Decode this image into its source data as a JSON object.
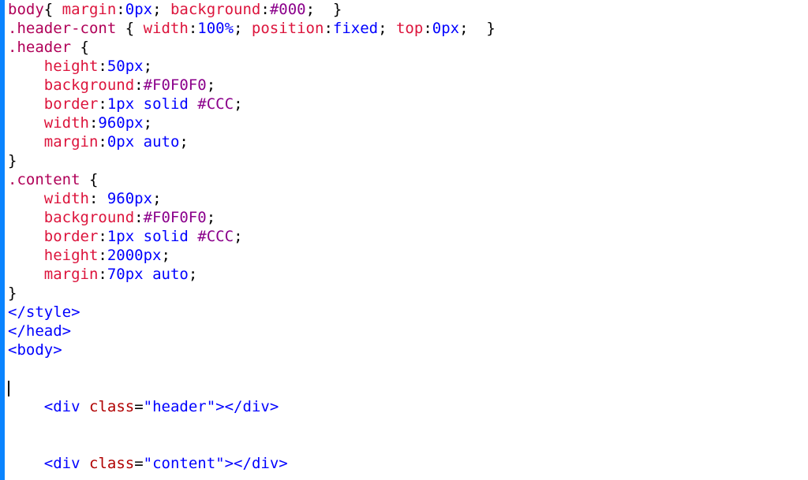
{
  "lines": [
    {
      "indent": 0,
      "tokens": [
        {
          "t": "body",
          "c": "sel"
        },
        {
          "t": "{ ",
          "c": "brace"
        },
        {
          "t": "margin",
          "c": "prop"
        },
        {
          "t": ":",
          "c": "punct"
        },
        {
          "t": "0px",
          "c": "num"
        },
        {
          "t": "; ",
          "c": "punct"
        },
        {
          "t": "background",
          "c": "prop"
        },
        {
          "t": ":",
          "c": "punct"
        },
        {
          "t": "#000",
          "c": "col"
        },
        {
          "t": "; ",
          "c": "punct"
        },
        {
          "t": " }",
          "c": "brace"
        }
      ]
    },
    {
      "indent": 0,
      "tokens": [
        {
          "t": ".header-cont",
          "c": "sel"
        },
        {
          "t": " { ",
          "c": "brace"
        },
        {
          "t": "width",
          "c": "prop"
        },
        {
          "t": ":",
          "c": "punct"
        },
        {
          "t": "100%",
          "c": "pct"
        },
        {
          "t": "; ",
          "c": "punct"
        },
        {
          "t": "position",
          "c": "prop"
        },
        {
          "t": ":",
          "c": "punct"
        },
        {
          "t": "fixed",
          "c": "kw"
        },
        {
          "t": "; ",
          "c": "punct"
        },
        {
          "t": "top",
          "c": "prop"
        },
        {
          "t": ":",
          "c": "punct"
        },
        {
          "t": "0px",
          "c": "num"
        },
        {
          "t": "; ",
          "c": "punct"
        },
        {
          "t": " }",
          "c": "brace"
        }
      ]
    },
    {
      "indent": 0,
      "tokens": [
        {
          "t": ".header",
          "c": "sel"
        },
        {
          "t": " {",
          "c": "brace"
        }
      ]
    },
    {
      "indent": 1,
      "tokens": [
        {
          "t": "height",
          "c": "prop"
        },
        {
          "t": ":",
          "c": "punct"
        },
        {
          "t": "50px",
          "c": "num"
        },
        {
          "t": ";",
          "c": "punct"
        }
      ]
    },
    {
      "indent": 1,
      "tokens": [
        {
          "t": "background",
          "c": "prop"
        },
        {
          "t": ":",
          "c": "punct"
        },
        {
          "t": "#F0F0F0",
          "c": "col"
        },
        {
          "t": ";",
          "c": "punct"
        }
      ]
    },
    {
      "indent": 1,
      "tokens": [
        {
          "t": "border",
          "c": "prop"
        },
        {
          "t": ":",
          "c": "punct"
        },
        {
          "t": "1px",
          "c": "num"
        },
        {
          "t": " ",
          "c": "punct"
        },
        {
          "t": "solid",
          "c": "kw"
        },
        {
          "t": " ",
          "c": "punct"
        },
        {
          "t": "#CCC",
          "c": "col"
        },
        {
          "t": ";",
          "c": "punct"
        }
      ]
    },
    {
      "indent": 1,
      "tokens": [
        {
          "t": "width",
          "c": "prop"
        },
        {
          "t": ":",
          "c": "punct"
        },
        {
          "t": "960px",
          "c": "num"
        },
        {
          "t": ";",
          "c": "punct"
        }
      ]
    },
    {
      "indent": 1,
      "tokens": [
        {
          "t": "margin",
          "c": "prop"
        },
        {
          "t": ":",
          "c": "punct"
        },
        {
          "t": "0px",
          "c": "num"
        },
        {
          "t": " ",
          "c": "punct"
        },
        {
          "t": "auto",
          "c": "kw"
        },
        {
          "t": ";",
          "c": "punct"
        }
      ]
    },
    {
      "indent": 0,
      "tokens": [
        {
          "t": "}",
          "c": "brace"
        }
      ]
    },
    {
      "indent": 0,
      "tokens": [
        {
          "t": ".content",
          "c": "sel"
        },
        {
          "t": " {",
          "c": "brace"
        }
      ]
    },
    {
      "indent": 1,
      "tokens": [
        {
          "t": "width",
          "c": "prop"
        },
        {
          "t": ": ",
          "c": "punct"
        },
        {
          "t": "960px",
          "c": "num"
        },
        {
          "t": ";",
          "c": "punct"
        }
      ]
    },
    {
      "indent": 1,
      "tokens": [
        {
          "t": "background",
          "c": "prop"
        },
        {
          "t": ":",
          "c": "punct"
        },
        {
          "t": "#F0F0F0",
          "c": "col"
        },
        {
          "t": ";",
          "c": "punct"
        }
      ]
    },
    {
      "indent": 1,
      "tokens": [
        {
          "t": "border",
          "c": "prop"
        },
        {
          "t": ":",
          "c": "punct"
        },
        {
          "t": "1px",
          "c": "num"
        },
        {
          "t": " ",
          "c": "punct"
        },
        {
          "t": "solid",
          "c": "kw"
        },
        {
          "t": " ",
          "c": "punct"
        },
        {
          "t": "#CCC",
          "c": "col"
        },
        {
          "t": ";",
          "c": "punct"
        }
      ]
    },
    {
      "indent": 1,
      "tokens": [
        {
          "t": "height",
          "c": "prop"
        },
        {
          "t": ":",
          "c": "punct"
        },
        {
          "t": "2000px",
          "c": "num"
        },
        {
          "t": ";",
          "c": "punct"
        }
      ]
    },
    {
      "indent": 1,
      "tokens": [
        {
          "t": "margin",
          "c": "prop"
        },
        {
          "t": ":",
          "c": "punct"
        },
        {
          "t": "70px",
          "c": "num"
        },
        {
          "t": " ",
          "c": "punct"
        },
        {
          "t": "auto",
          "c": "kw"
        },
        {
          "t": ";",
          "c": "punct"
        }
      ]
    },
    {
      "indent": 0,
      "tokens": [
        {
          "t": "}",
          "c": "brace"
        }
      ]
    },
    {
      "indent": 0,
      "tokens": [
        {
          "t": "</",
          "c": "tag"
        },
        {
          "t": "style",
          "c": "tag"
        },
        {
          "t": ">",
          "c": "tag"
        }
      ]
    },
    {
      "indent": 0,
      "tokens": [
        {
          "t": "</",
          "c": "tag"
        },
        {
          "t": "head",
          "c": "tag"
        },
        {
          "t": ">",
          "c": "tag"
        }
      ]
    },
    {
      "indent": 0,
      "tokens": [
        {
          "t": "<",
          "c": "tag"
        },
        {
          "t": "body",
          "c": "tag"
        },
        {
          "t": ">",
          "c": "tag"
        }
      ]
    },
    {
      "indent": 0,
      "tokens": [],
      "blank": true
    },
    {
      "indent": 0,
      "tokens": [],
      "caret": true
    },
    {
      "indent": 1,
      "tokens": [
        {
          "t": "<",
          "c": "tag"
        },
        {
          "t": "div",
          "c": "tag"
        },
        {
          "t": " ",
          "c": "punct"
        },
        {
          "t": "class",
          "c": "attr"
        },
        {
          "t": "=",
          "c": "punct"
        },
        {
          "t": "\"header\"",
          "c": "str"
        },
        {
          "t": "></",
          "c": "tag"
        },
        {
          "t": "div",
          "c": "tag"
        },
        {
          "t": ">",
          "c": "tag"
        }
      ]
    },
    {
      "indent": 0,
      "tokens": [],
      "blank": true
    },
    {
      "indent": 0,
      "tokens": [],
      "blank": true
    },
    {
      "indent": 1,
      "tokens": [
        {
          "t": "<",
          "c": "tag"
        },
        {
          "t": "div",
          "c": "tag"
        },
        {
          "t": " ",
          "c": "punct"
        },
        {
          "t": "class",
          "c": "attr"
        },
        {
          "t": "=",
          "c": "punct"
        },
        {
          "t": "\"content\"",
          "c": "str"
        },
        {
          "t": "></",
          "c": "tag"
        },
        {
          "t": "div",
          "c": "tag"
        },
        {
          "t": ">",
          "c": "tag"
        }
      ]
    }
  ],
  "indent_unit": "    "
}
